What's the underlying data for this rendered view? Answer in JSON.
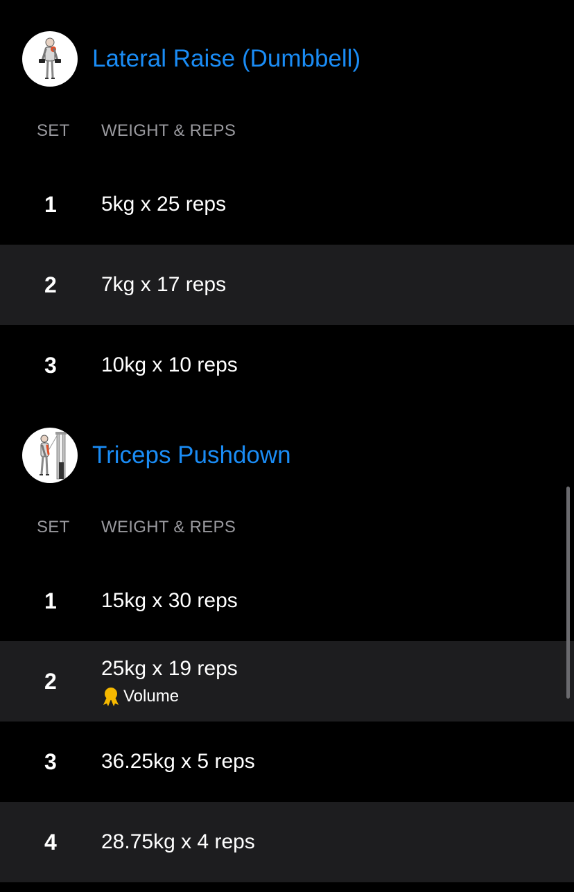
{
  "colors": {
    "accent": "#1a8cf5",
    "background": "#000000",
    "row_alt": "#1d1d1f",
    "header_text": "#9a9a9f",
    "medal": "#f5b800"
  },
  "exercises": [
    {
      "title": "Lateral Raise (Dumbbell)",
      "thumbnail_icon": "lateral-raise-figure-icon",
      "col_set": "SET",
      "col_weight_reps": "WEIGHT & REPS",
      "sets": [
        {
          "num": "1",
          "value": "5kg x 25 reps"
        },
        {
          "num": "2",
          "value": "7kg x 17 reps"
        },
        {
          "num": "3",
          "value": "10kg x 10 reps"
        }
      ]
    },
    {
      "title": "Triceps Pushdown",
      "thumbnail_icon": "triceps-pushdown-figure-icon",
      "col_set": "SET",
      "col_weight_reps": "WEIGHT & REPS",
      "sets": [
        {
          "num": "1",
          "value": "15kg x 30 reps"
        },
        {
          "num": "2",
          "value": "25kg x 19 reps",
          "record": "Volume",
          "record_icon": "medal-icon"
        },
        {
          "num": "3",
          "value": "36.25kg x 5 reps"
        },
        {
          "num": "4",
          "value": "28.75kg x 4 reps"
        }
      ]
    }
  ]
}
